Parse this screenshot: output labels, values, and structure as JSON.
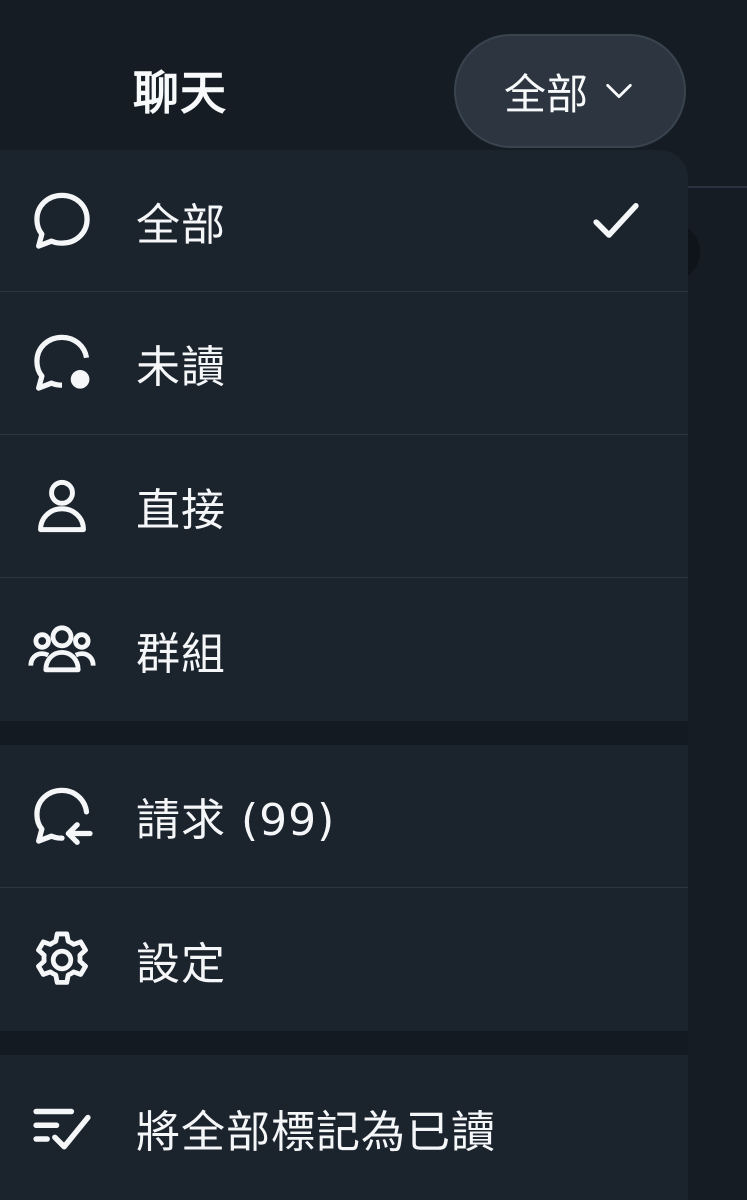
{
  "header": {
    "title": "聊天",
    "filter_button_label": "全部"
  },
  "menu": {
    "items": [
      {
        "label": "全部",
        "icon": "chat-bubble-icon",
        "selected": true
      },
      {
        "label": "未讀",
        "icon": "chat-bubble-unread-icon",
        "selected": false
      },
      {
        "label": "直接",
        "icon": "person-icon",
        "selected": false
      },
      {
        "label": "群組",
        "icon": "people-group-icon",
        "selected": false
      },
      {
        "label": "請求 (99)",
        "icon": "chat-bubble-request-icon",
        "selected": false
      },
      {
        "label": "設定",
        "icon": "gear-icon",
        "selected": false
      },
      {
        "label": "將全部標記為已讀",
        "icon": "mark-all-read-icon",
        "selected": false
      }
    ]
  },
  "colors": {
    "page_background": "#151c24",
    "menu_background": "#1b232d",
    "pill_background": "#2c3540",
    "text": "#f4f6f8",
    "separator": "#2c3641"
  }
}
